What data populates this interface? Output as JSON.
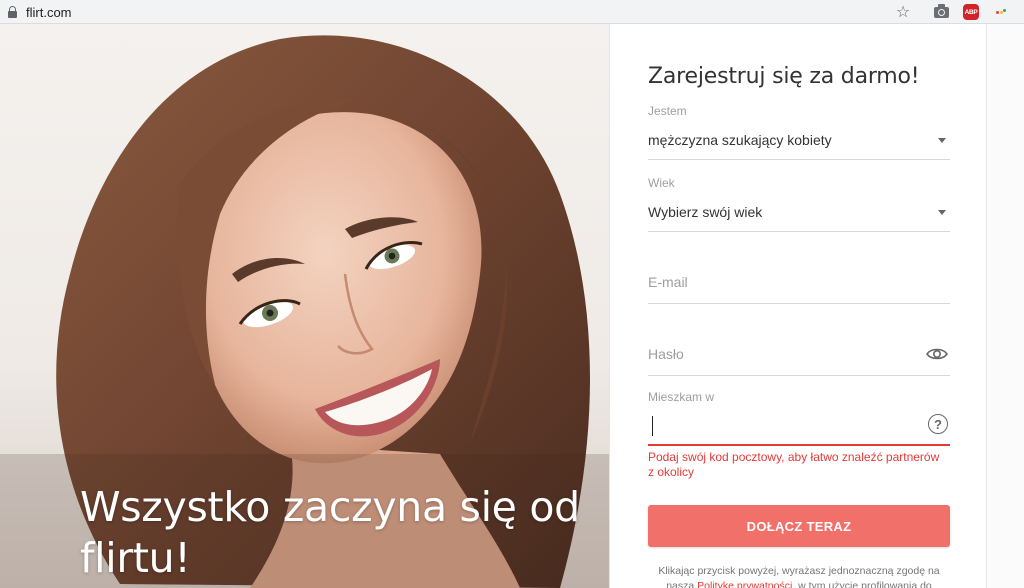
{
  "browser": {
    "url": "flirt.com",
    "abp_label": "ABP"
  },
  "hero": {
    "headline": "Wszystko zaczyna się od flirtu!"
  },
  "form": {
    "title": "Zarejestruj się za darmo!",
    "gender": {
      "label": "Jestem",
      "value": "mężczyzna szukający kobiety"
    },
    "age": {
      "label": "Wiek",
      "value": "Wybierz swój wiek"
    },
    "email": {
      "placeholder": "E-mail"
    },
    "password": {
      "placeholder": "Hasło"
    },
    "location": {
      "label": "Mieszkam w",
      "value": "",
      "error": "Podaj swój kod pocztowy, aby łatwo znaleźć partnerów z okolicy"
    },
    "submit_label": "DOŁĄCZ TERAZ",
    "consent": {
      "before": "Klikając przycisk powyżej, wyrażasz jednoznaczną zgodę na",
      "line2_start": "naszą",
      "link": "Politykę prywatności",
      "after": ", w tym użycie profilowania do"
    }
  },
  "colors": {
    "accent": "#f1706a",
    "error": "#e53935",
    "abp": "#d1232a"
  },
  "icons": [
    "lock-icon",
    "star-icon",
    "camera-icon",
    "adblock-icon",
    "extension-icon",
    "dropdown-caret-icon",
    "eye-icon",
    "help-icon"
  ]
}
